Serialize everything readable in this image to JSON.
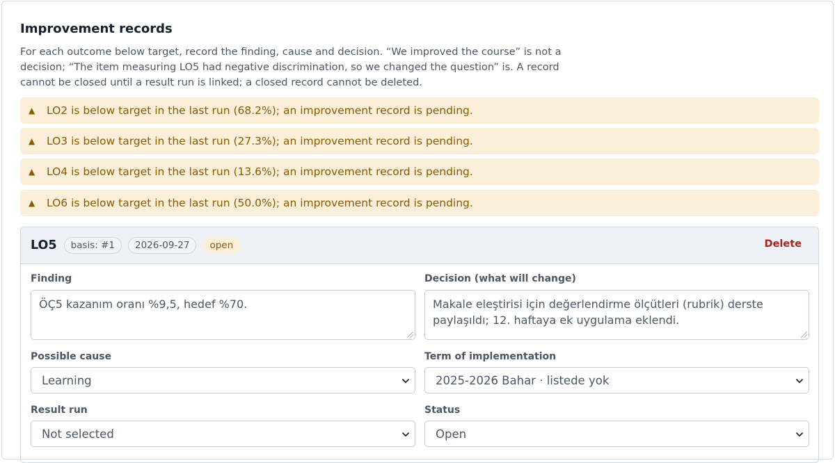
{
  "section": {
    "title": "Improvement records",
    "intro": "For each outcome below target, record the finding, cause and decision. “We improved the course” is not a decision; “The item measuring LO5 had negative discrimination, so we changed the question” is. A record cannot be closed until a result run is linked; a closed record cannot be deleted."
  },
  "warnings": [
    "LO2 is below target in the last run (68.2%); an improvement record is pending.",
    "LO3 is below target in the last run (27.3%); an improvement record is pending.",
    "LO4 is below target in the last run (13.6%); an improvement record is pending.",
    "LO6 is below target in the last run (50.0%); an improvement record is pending."
  ],
  "warning_icon": "▲",
  "colors": {
    "warning_bg": "#fbefd9",
    "warning_text": "#8a5a00",
    "danger": "#a8241d"
  },
  "record": {
    "code": "LO5",
    "basis": "basis: #1",
    "date": "2026-09-27",
    "status_badge": "open",
    "delete_label": "Delete",
    "finding_label": "Finding",
    "finding_value": "ÖÇ5 kazanım oranı %9,5, hedef %70.",
    "decision_label": "Decision (what will change)",
    "decision_value": "Makale eleştirisi için değerlendirme ölçütleri (rubrik) derste paylaşıldı; 12. haftaya ek uygulama eklendi.",
    "cause_label": "Possible cause",
    "cause_value": "Learning",
    "term_label": "Term of implementation",
    "term_value": "2025-2026 Bahar · listede yok",
    "result_label": "Result run",
    "result_value": "Not selected",
    "status_label": "Status",
    "status_value": "Open"
  }
}
